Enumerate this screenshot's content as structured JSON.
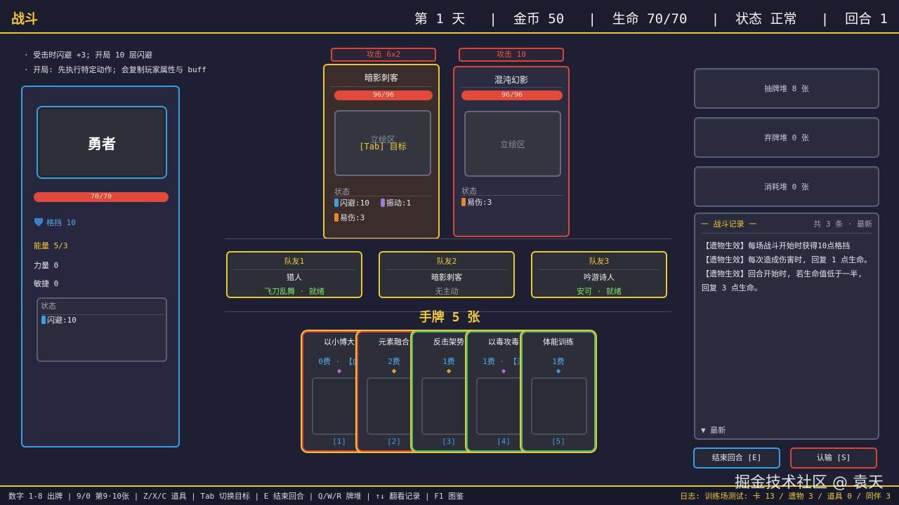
{
  "topbar": {
    "title": "战斗",
    "stats": "第 1 天   |  金币 50   |  生命 70/70   |  状态 正常   |  回合 1"
  },
  "hints": [
    "· 受击时闪避 +3; 开局 10 层闪避",
    "· 开局: 先执行特定动作; 会复制玩家属性与 buff"
  ],
  "player": {
    "name": "勇者",
    "hp": "70/70",
    "hp_fraction": 1.0,
    "block": "格挡 10",
    "energy": "能量 5/3",
    "strength": "力量 0",
    "agility": "敏捷 0",
    "status_title": "状态",
    "statuses": [
      {
        "label": "闪避:10",
        "color": "#3a9fe0"
      }
    ]
  },
  "enemies": [
    {
      "intent": "攻击 6x2",
      "name": "暗影刺客",
      "hp": "96/96",
      "hp_fraction": 1.0,
      "portrait_label": "立绘区",
      "target_label": "[Tab] 目标",
      "status_title": "状态",
      "statuses": [
        {
          "label": "闪避:10",
          "color": "#3a9fe0"
        },
        {
          "label": "振动:1",
          "color": "#a07ad8"
        },
        {
          "label": "易伤:3",
          "color": "#e8842a"
        }
      ],
      "border": "#e8c73a"
    },
    {
      "intent": "攻击 10",
      "name": "混沌幻影",
      "hp": "96/96",
      "hp_fraction": 1.0,
      "portrait_label": "立绘区",
      "status_title": "状态",
      "statuses": [
        {
          "label": "易伤:3",
          "color": "#e8842a"
        }
      ],
      "border": "#d9453a"
    }
  ],
  "allies": [
    {
      "name": "队友1",
      "role": "猎人",
      "tags": "飞刀乱舞 · 就绪",
      "tag_color": "#7ee06a"
    },
    {
      "name": "队友2",
      "role": "暗影刺客",
      "tags": "无主动",
      "tag_color": "#9a9cae"
    },
    {
      "name": "队友3",
      "role": "吟游诗人",
      "tags": "安可 · 就绪",
      "tag_color": "#7ee06a"
    }
  ],
  "hand_title": "手牌 5 张",
  "cards": [
    {
      "name": "以小博大",
      "cost": "0费 · 【虚",
      "gem": "◆",
      "gem_color": "#b06ad8",
      "key": "[1]",
      "border": "#d9453a"
    },
    {
      "name": "元素融合",
      "cost": "2费",
      "gem": "◆",
      "gem_color": "#e8a02a",
      "key": "[2]",
      "border": "#d9453a"
    },
    {
      "name": "反击架势",
      "cost": "1费",
      "gem": "◆",
      "gem_color": "#e8a02a",
      "key": "[3]",
      "border": "#4ab86a"
    },
    {
      "name": "以毒攻毒",
      "cost": "1费 · 【消",
      "gem": "◆",
      "gem_color": "#b06ad8",
      "key": "[4]",
      "border": "#4ab86a"
    },
    {
      "name": "体能训练",
      "cost": "1费",
      "gem": "◆",
      "gem_color": "#3a9fe0",
      "key": "[5]",
      "border": "#4ab86a"
    }
  ],
  "piles": {
    "draw": "抽牌堆 8 张",
    "discard": "弃牌堆 0 张",
    "exhaust": "消耗堆 0 张"
  },
  "log": {
    "title": "一 战斗记录 一",
    "meta": "共 3 条 · 最新",
    "entries": [
      "【遗物生效】每场战斗开始时获得10点格挡",
      "【遗物生效】每次造成伤害时, 回复 1 点生命。",
      "【遗物生效】回合开始时, 若生命值低于一半, 回复 3 点生命。"
    ],
    "footer": "▼ 最新"
  },
  "buttons": {
    "end_turn": "结束回合 [E]",
    "surrender": "认输 [S]"
  },
  "bottombar": {
    "keys": "数字 1-8 出牌 | 9/0 第9·10张 | Z/X/C 道具 | Tab 切换目标 | E 结束回合 | Q/W/R 牌堆 | ↑↓ 翻看记录 | F1 图鉴",
    "log_summary": "日志: 训练场测试: 卡 13 / 遗物 3 / 道具 0 / 同伴 3"
  },
  "watermark": "掘金技术社区 @ 袁天",
  "colors": {
    "accent": "#e8c73a",
    "hp": "#e14a3a",
    "player": "#3a9fe0"
  }
}
